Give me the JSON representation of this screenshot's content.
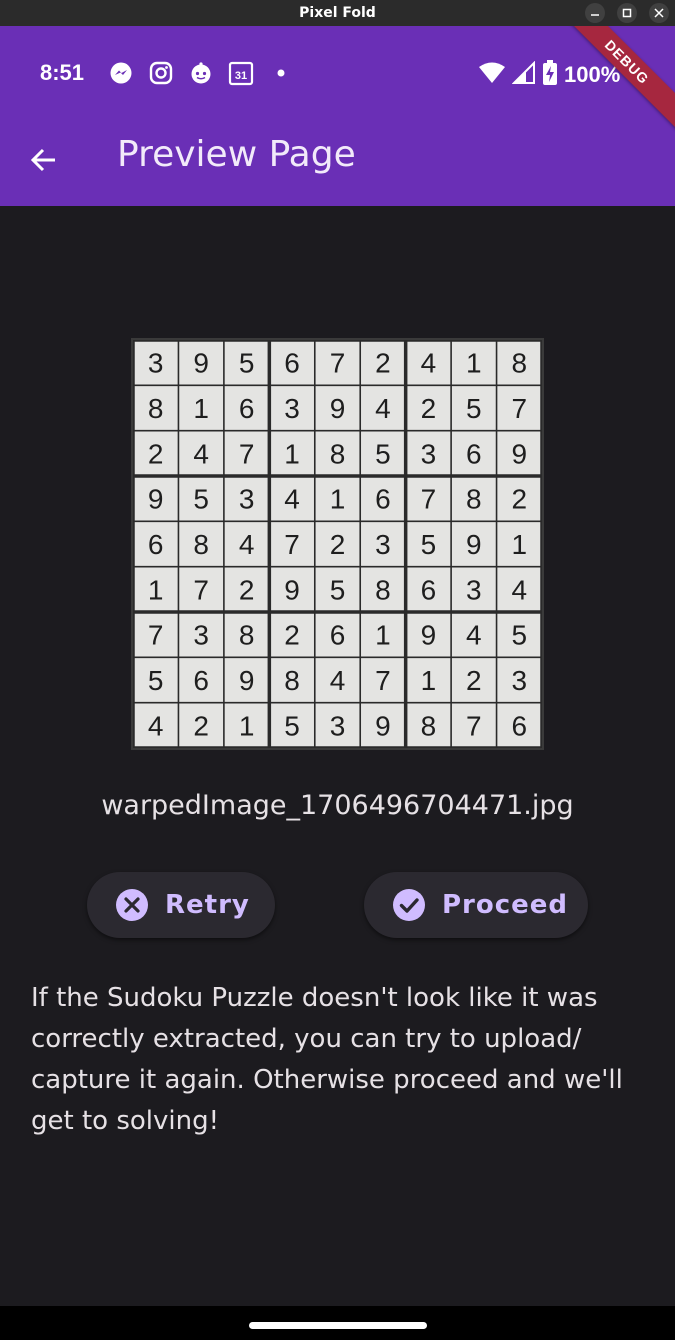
{
  "window": {
    "title": "Pixel Fold"
  },
  "status_bar": {
    "time": "8:51",
    "notification_icons": [
      "messenger-icon",
      "instagram-icon",
      "reddit-icon",
      "calendar-icon",
      "dot-icon"
    ],
    "calendar_day": "31",
    "battery": "100%"
  },
  "debug_banner": "DEBUG",
  "app_bar": {
    "title": "Preview Page"
  },
  "sudoku": {
    "rows": [
      [
        "3",
        "9",
        "5",
        "6",
        "7",
        "2",
        "4",
        "1",
        "8"
      ],
      [
        "8",
        "1",
        "6",
        "3",
        "9",
        "4",
        "2",
        "5",
        "7"
      ],
      [
        "2",
        "4",
        "7",
        "1",
        "8",
        "5",
        "3",
        "6",
        "9"
      ],
      [
        "9",
        "5",
        "3",
        "4",
        "1",
        "6",
        "7",
        "8",
        "2"
      ],
      [
        "6",
        "8",
        "4",
        "7",
        "2",
        "3",
        "5",
        "9",
        "1"
      ],
      [
        "1",
        "7",
        "2",
        "9",
        "5",
        "8",
        "6",
        "3",
        "4"
      ],
      [
        "7",
        "3",
        "8",
        "2",
        "6",
        "1",
        "9",
        "4",
        "5"
      ],
      [
        "5",
        "6",
        "9",
        "8",
        "4",
        "7",
        "1",
        "2",
        "3"
      ],
      [
        "4",
        "2",
        "1",
        "5",
        "3",
        "9",
        "8",
        "7",
        "6"
      ]
    ]
  },
  "filename": "warpedImage_1706496704471.jpg",
  "buttons": {
    "retry": "Retry",
    "proceed": "Proceed"
  },
  "message": "If the Sudoku Puzzle doesn't look like it was correctly extracted, you can try to upload/ capture it again. Otherwise proceed and we'll get to solving!",
  "colors": {
    "app_bar": "#6a2fb6",
    "background": "#1c1b1f",
    "accent": "#d0bcff",
    "button_bg": "#2b2930"
  }
}
